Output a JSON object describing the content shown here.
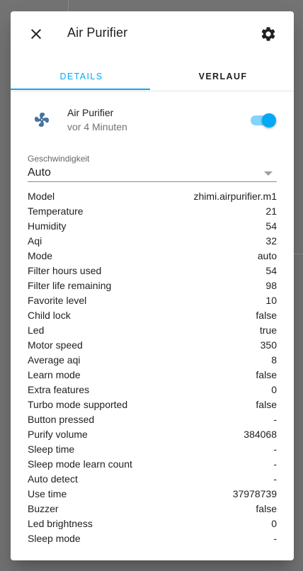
{
  "dialog": {
    "title": "Air Purifier"
  },
  "tabs": [
    {
      "label": "DETAILS",
      "active": true
    },
    {
      "label": "VERLAUF",
      "active": false
    }
  ],
  "entity": {
    "icon": "fan-icon",
    "name": "Air Purifier",
    "last_changed": "vor 4 Minuten",
    "state_on": true
  },
  "speed_select": {
    "label": "Geschwindigkeit",
    "value": "Auto"
  },
  "attributes": [
    {
      "name": "Model",
      "value": "zhimi.airpurifier.m1"
    },
    {
      "name": "Temperature",
      "value": "21"
    },
    {
      "name": "Humidity",
      "value": "54"
    },
    {
      "name": "Aqi",
      "value": "32"
    },
    {
      "name": "Mode",
      "value": "auto"
    },
    {
      "name": "Filter hours used",
      "value": "54"
    },
    {
      "name": "Filter life remaining",
      "value": "98"
    },
    {
      "name": "Favorite level",
      "value": "10"
    },
    {
      "name": "Child lock",
      "value": "false"
    },
    {
      "name": "Led",
      "value": "true"
    },
    {
      "name": "Motor speed",
      "value": "350"
    },
    {
      "name": "Average aqi",
      "value": "8"
    },
    {
      "name": "Learn mode",
      "value": "false"
    },
    {
      "name": "Extra features",
      "value": "0"
    },
    {
      "name": "Turbo mode supported",
      "value": "false"
    },
    {
      "name": "Button pressed",
      "value": "-"
    },
    {
      "name": "Purify volume",
      "value": "384068"
    },
    {
      "name": "Sleep time",
      "value": "-"
    },
    {
      "name": "Sleep mode learn count",
      "value": "-"
    },
    {
      "name": "Auto detect",
      "value": "-"
    },
    {
      "name": "Use time",
      "value": "37978739"
    },
    {
      "name": "Buzzer",
      "value": "false"
    },
    {
      "name": "Led brightness",
      "value": "0"
    },
    {
      "name": "Sleep mode",
      "value": "-"
    }
  ],
  "colors": {
    "accent": "#03a9f4",
    "accent_light": "#81d4fa",
    "fan_icon": "#44739e"
  }
}
